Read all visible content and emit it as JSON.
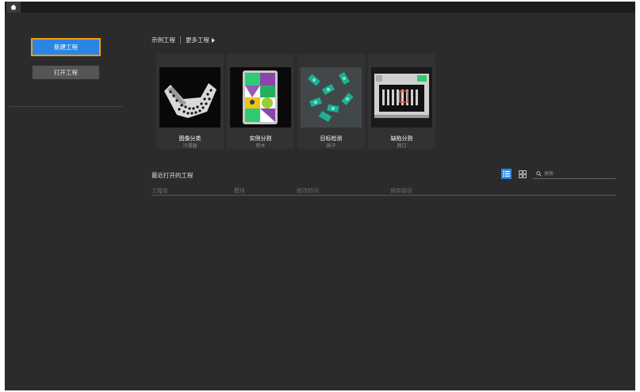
{
  "tabs": {
    "home_icon": "home-icon"
  },
  "sidebar": {
    "new_project": "新建工程",
    "open_project": "打开工程"
  },
  "sections": {
    "examples": "示例工程",
    "more": "更多工程"
  },
  "examples": [
    {
      "title": "图像分类",
      "subtitle": "冷凝器"
    },
    {
      "title": "实例分割",
      "subtitle": "积木"
    },
    {
      "title": "目标检测",
      "subtitle": "铸子"
    },
    {
      "title": "缺陷分割",
      "subtitle": "网口"
    }
  ],
  "recent": {
    "title": "最近打开的工程",
    "search_placeholder": "搜索",
    "columns": [
      "工程名",
      "模块",
      "修改时间",
      "保存路径"
    ]
  },
  "colors": {
    "accent": "#2b85e4",
    "focus": "#f39c12",
    "background": "#2b2b2b"
  }
}
